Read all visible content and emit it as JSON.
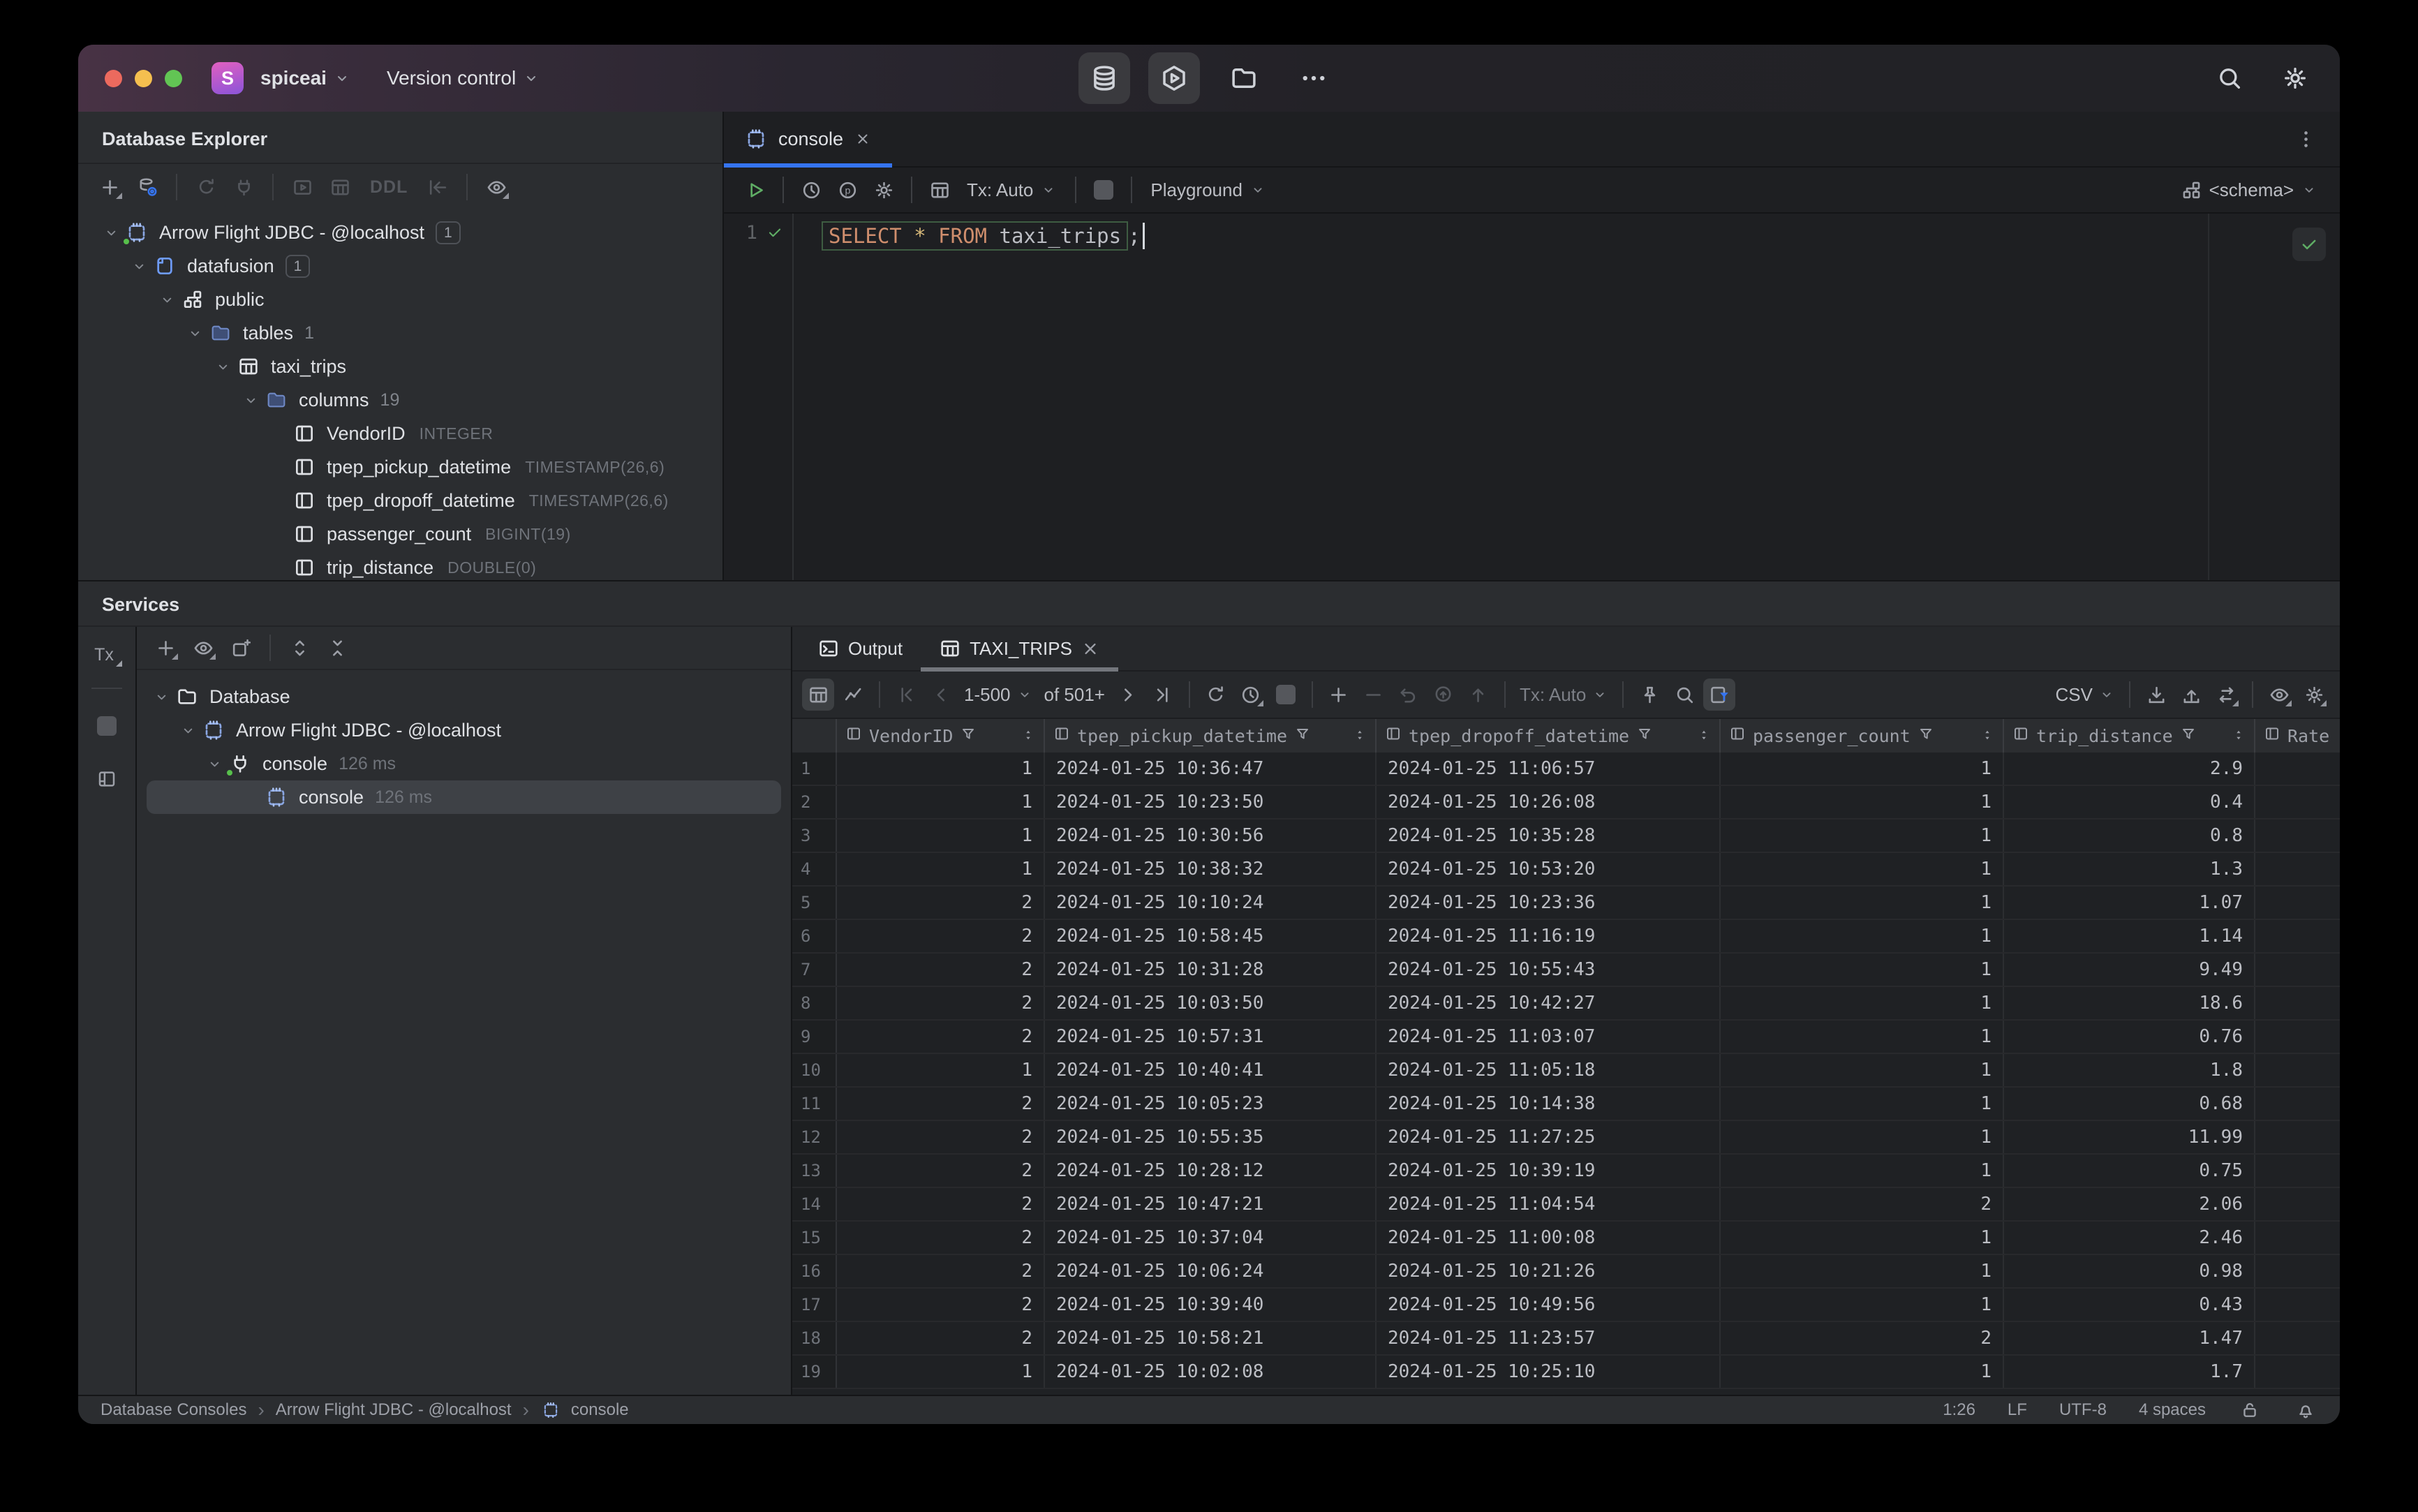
{
  "titlebar": {
    "avatar_letter": "S",
    "project": "spiceai",
    "vcs": "Version control"
  },
  "database_explorer": {
    "title": "Database Explorer",
    "toolbar_ddl": "DDL",
    "tree": [
      {
        "level": 0,
        "icon": "datasource",
        "chevron": true,
        "label": "Arrow Flight JDBC - @localhost",
        "badge": "1",
        "connected": true
      },
      {
        "level": 1,
        "icon": "dbblue",
        "chevron": true,
        "label": "datafusion",
        "badge": "1"
      },
      {
        "level": 2,
        "icon": "schema",
        "chevron": true,
        "label": "public"
      },
      {
        "level": 3,
        "icon": "folder",
        "chevron": true,
        "label": "tables",
        "count": "1"
      },
      {
        "level": 4,
        "icon": "tablegrid",
        "chevron": true,
        "label": "taxi_trips"
      },
      {
        "level": 5,
        "icon": "folder",
        "chevron": true,
        "label": "columns",
        "count": "19"
      },
      {
        "level": 6,
        "icon": "colglyph",
        "label": "VendorID",
        "type": "INTEGER"
      },
      {
        "level": 6,
        "icon": "colglyph",
        "label": "tpep_pickup_datetime",
        "type": "TIMESTAMP(26,6)"
      },
      {
        "level": 6,
        "icon": "colglyph",
        "label": "tpep_dropoff_datetime",
        "type": "TIMESTAMP(26,6)"
      },
      {
        "level": 6,
        "icon": "colglyph",
        "label": "passenger_count",
        "type": "BIGINT(19)"
      },
      {
        "level": 6,
        "icon": "colglyph",
        "label": "trip_distance",
        "type": "DOUBLE(0)"
      }
    ]
  },
  "editor": {
    "tab_label": "console",
    "tx_mode": "Tx: Auto",
    "playground": "Playground",
    "schema_selector": "<schema>",
    "line_number": "1",
    "sql_tokens": {
      "select": "SELECT",
      "star": "*",
      "from": "FROM",
      "table": "taxi_trips",
      "semicolon": ";"
    }
  },
  "services": {
    "title": "Services",
    "tx_label": "Tx",
    "tree": [
      {
        "level": 0,
        "icon": "folderout",
        "chevron": true,
        "label": "Database"
      },
      {
        "level": 1,
        "icon": "datasource",
        "chevron": true,
        "label": "Arrow Flight JDBC - @localhost"
      },
      {
        "level": 2,
        "icon": "plug",
        "chevron": true,
        "label": "console",
        "meta": "126 ms",
        "connected": true
      },
      {
        "level": 3,
        "icon": "datasource",
        "label": "console",
        "meta": "126 ms",
        "selected": true
      }
    ]
  },
  "results": {
    "tabs": [
      {
        "label": "Output",
        "icon": "terminal"
      },
      {
        "label": "TAXI_TRIPS",
        "icon": "tablegrid",
        "closable": true,
        "active": true
      }
    ],
    "pagination": {
      "range": "1-500",
      "total": "of 501+"
    },
    "tx_mode": "Tx: Auto",
    "export_format": "CSV",
    "columns": [
      {
        "label": "VendorID",
        "filter": true,
        "sort": true
      },
      {
        "label": "tpep_pickup_datetime",
        "filter": true,
        "sort": true
      },
      {
        "label": "tpep_dropoff_datetime",
        "filter": true,
        "sort": true
      },
      {
        "label": "passenger_count",
        "filter": true,
        "sort": true
      },
      {
        "label": "trip_distance",
        "filter": true,
        "sort": true
      },
      {
        "label": "Rate",
        "filter": false,
        "sort": false
      }
    ],
    "rows": [
      [
        "1",
        "2024-01-25 10:36:47",
        "2024-01-25 11:06:57",
        "1",
        "2.9",
        ""
      ],
      [
        "1",
        "2024-01-25 10:23:50",
        "2024-01-25 10:26:08",
        "1",
        "0.4",
        ""
      ],
      [
        "1",
        "2024-01-25 10:30:56",
        "2024-01-25 10:35:28",
        "1",
        "0.8",
        ""
      ],
      [
        "1",
        "2024-01-25 10:38:32",
        "2024-01-25 10:53:20",
        "1",
        "1.3",
        ""
      ],
      [
        "2",
        "2024-01-25 10:10:24",
        "2024-01-25 10:23:36",
        "1",
        "1.07",
        ""
      ],
      [
        "2",
        "2024-01-25 10:58:45",
        "2024-01-25 11:16:19",
        "1",
        "1.14",
        ""
      ],
      [
        "2",
        "2024-01-25 10:31:28",
        "2024-01-25 10:55:43",
        "1",
        "9.49",
        ""
      ],
      [
        "2",
        "2024-01-25 10:03:50",
        "2024-01-25 10:42:27",
        "1",
        "18.6",
        ""
      ],
      [
        "2",
        "2024-01-25 10:57:31",
        "2024-01-25 11:03:07",
        "1",
        "0.76",
        ""
      ],
      [
        "1",
        "2024-01-25 10:40:41",
        "2024-01-25 11:05:18",
        "1",
        "1.8",
        ""
      ],
      [
        "2",
        "2024-01-25 10:05:23",
        "2024-01-25 10:14:38",
        "1",
        "0.68",
        ""
      ],
      [
        "2",
        "2024-01-25 10:55:35",
        "2024-01-25 11:27:25",
        "1",
        "11.99",
        ""
      ],
      [
        "2",
        "2024-01-25 10:28:12",
        "2024-01-25 10:39:19",
        "1",
        "0.75",
        ""
      ],
      [
        "2",
        "2024-01-25 10:47:21",
        "2024-01-25 11:04:54",
        "2",
        "2.06",
        ""
      ],
      [
        "2",
        "2024-01-25 10:37:04",
        "2024-01-25 11:00:08",
        "1",
        "2.46",
        ""
      ],
      [
        "2",
        "2024-01-25 10:06:24",
        "2024-01-25 10:21:26",
        "1",
        "0.98",
        ""
      ],
      [
        "2",
        "2024-01-25 10:39:40",
        "2024-01-25 10:49:56",
        "1",
        "0.43",
        ""
      ],
      [
        "2",
        "2024-01-25 10:58:21",
        "2024-01-25 11:23:57",
        "2",
        "1.47",
        ""
      ],
      [
        "1",
        "2024-01-25 10:02:08",
        "2024-01-25 10:25:10",
        "1",
        "1.7",
        ""
      ]
    ]
  },
  "statusbar": {
    "breadcrumbs": [
      "Database Consoles",
      "Arrow Flight JDBC - @localhost",
      "console"
    ],
    "caret_position": "1:26",
    "line_separator": "LF",
    "encoding": "UTF-8",
    "indent": "4 spaces"
  },
  "colors": {
    "accent": "#3574f0",
    "run_green": "#5fad65",
    "keyword": "#cf8e6d"
  }
}
